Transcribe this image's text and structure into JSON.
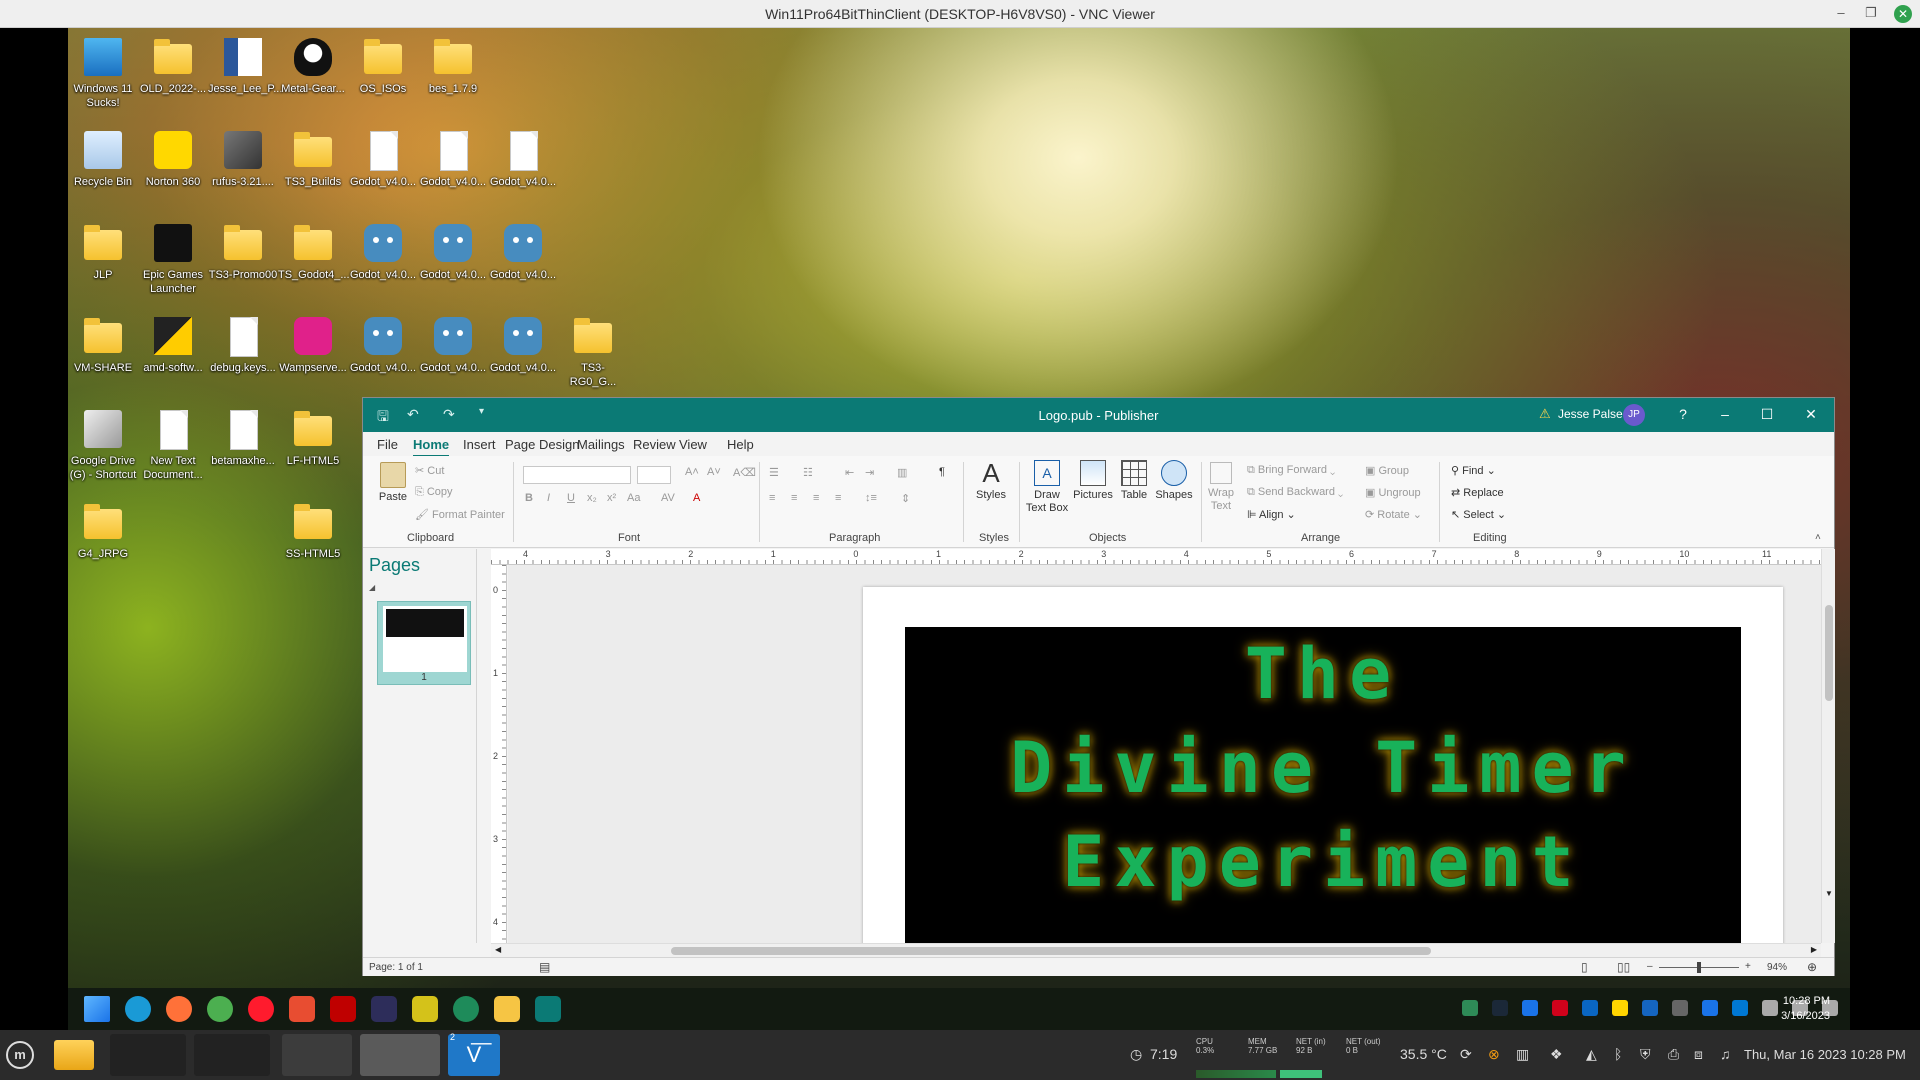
{
  "vnc": {
    "title": "Win11Pro64BitThinClient (DESKTOP-H6V8VS0) - VNC Viewer"
  },
  "desktop_icons": [
    {
      "label": "Windows 11 Sucks!",
      "icon": "monitor-icon"
    },
    {
      "label": "OLD_2022-...",
      "icon": "folder-icon"
    },
    {
      "label": "Jesse_Lee_P...",
      "icon": "word-doc-icon"
    },
    {
      "label": "Metal-Gear...",
      "icon": "penguin-icon"
    },
    {
      "label": "OS_ISOs",
      "icon": "folder-icon"
    },
    {
      "label": "bes_1.7.9",
      "icon": "folder-icon"
    },
    {
      "label": "Recycle Bin",
      "icon": "recycle-bin-icon"
    },
    {
      "label": "Norton 360",
      "icon": "norton-icon"
    },
    {
      "label": "rufus-3.21....",
      "icon": "usb-icon"
    },
    {
      "label": "TS3_Builds",
      "icon": "folder-icon"
    },
    {
      "label": "Godot_v4.0...",
      "icon": "file-icon"
    },
    {
      "label": "Godot_v4.0...",
      "icon": "file-icon"
    },
    {
      "label": "Godot_v4.0...",
      "icon": "file-icon"
    },
    {
      "label": "JLP",
      "icon": "folder-icon"
    },
    {
      "label": "Epic Games Launcher",
      "icon": "epic-games-icon"
    },
    {
      "label": "TS3-Promo00",
      "icon": "folder-icon"
    },
    {
      "label": "TS_Godot4_...",
      "icon": "folder-icon"
    },
    {
      "label": "Godot_v4.0...",
      "icon": "godot-icon"
    },
    {
      "label": "Godot_v4.0...",
      "icon": "godot-icon"
    },
    {
      "label": "Godot_v4.0...",
      "icon": "godot-icon"
    },
    {
      "label": "VM-SHARE",
      "icon": "folder-icon"
    },
    {
      "label": "amd-softw...",
      "icon": "amd-icon"
    },
    {
      "label": "debug.keys...",
      "icon": "file-icon"
    },
    {
      "label": "Wampserve...",
      "icon": "wampserver-icon"
    },
    {
      "label": "Godot_v4.0...",
      "icon": "godot-console-icon"
    },
    {
      "label": "Godot_v4.0...",
      "icon": "godot-console-icon"
    },
    {
      "label": "Godot_v4.0...",
      "icon": "godot-console-icon"
    },
    {
      "label": "TS3-RG0_G...",
      "icon": "folder-icon"
    },
    {
      "label": "Google Drive (G) - Shortcut",
      "icon": "google-drive-icon"
    },
    {
      "label": "New Text Document...",
      "icon": "file-icon"
    },
    {
      "label": "betamaxhe...",
      "icon": "file-icon"
    },
    {
      "label": "LF-HTML5",
      "icon": "folder-icon"
    },
    {
      "label": "G4_JRPG",
      "icon": "folder-icon"
    },
    {
      "label": "SS-HTML5",
      "icon": "folder-icon"
    }
  ],
  "publisher": {
    "title": "Logo.pub  -  Publisher",
    "user": "Jesse Palser",
    "user_initials": "JP",
    "help": "?",
    "tabs": [
      "File",
      "Home",
      "Insert",
      "Page Design",
      "Mailings",
      "Review",
      "View",
      "Help"
    ],
    "active_tab": "Home",
    "ribbon": {
      "paste": "Paste",
      "cut": "Cut",
      "copy": "Copy",
      "format_painter": "Format Painter",
      "styles": "Styles",
      "draw_text_box": "Draw Text Box",
      "pictures": "Pictures",
      "table": "Table",
      "shapes": "Shapes",
      "wrap_text": "Wrap Text",
      "bring_forward": "Bring Forward",
      "send_backward": "Send Backward",
      "align": "Align",
      "group": "Group",
      "ungroup": "Ungroup",
      "rotate": "Rotate",
      "find": "Find",
      "replace": "Replace",
      "select": "Select",
      "groups": [
        "Clipboard",
        "Font",
        "Paragraph",
        "Styles",
        "Objects",
        "Arrange",
        "Editing"
      ]
    },
    "pages_pane": {
      "title": "Pages",
      "thumb_number": "1"
    },
    "ruler_h": [
      "4",
      "3",
      "2",
      "1",
      "0",
      "1",
      "2",
      "3",
      "4",
      "5",
      "6",
      "7",
      "8",
      "9",
      "10",
      "11"
    ],
    "ruler_v": [
      "0",
      "1",
      "2",
      "3",
      "4"
    ],
    "logo_lines": [
      "The",
      "Divine Timer",
      "Experiment"
    ],
    "status": {
      "page": "Page: 1 of 1",
      "zoom": "94%"
    }
  },
  "win_taskbar": {
    "pinned": [
      "start-icon",
      "edge-icon",
      "firefox-icon",
      "chrome-icon",
      "opera-icon",
      "git-icon",
      "filezilla-icon",
      "code-icon",
      "app-icon",
      "app2-icon",
      "explorer-icon",
      "publisher-icon"
    ],
    "time": "10:28 PM",
    "date": "3/16/2023"
  },
  "linux_panel": {
    "timer": "7:19",
    "cpu_label": "CPU",
    "cpu_value": "0.3%",
    "mem_label": "MEM",
    "mem_value": "7.77 GB",
    "net_in_label": "NET (in)",
    "net_in_value": "92 B",
    "net_out_label": "NET (out)",
    "net_out_value": "0 B",
    "temp": "35.5 °C",
    "datetime": "Thu, Mar 16 2023 10:28 PM",
    "vnc_badge": "2"
  },
  "colors": {
    "accent": "#0b7a75",
    "logo_text": "#18b25a",
    "logo_glow": "#c8a000"
  }
}
